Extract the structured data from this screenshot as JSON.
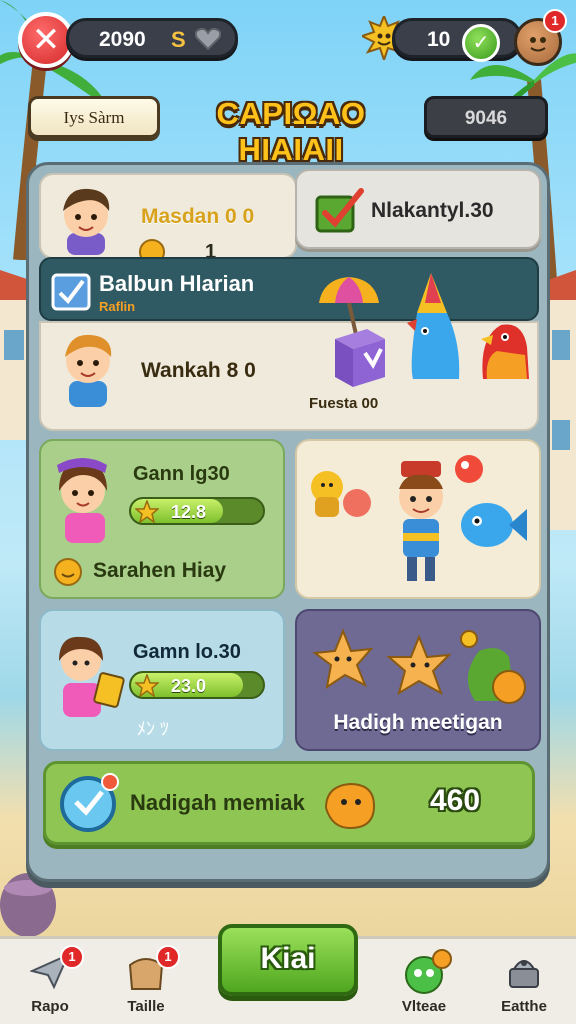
{
  "hud": {
    "coins": "2090",
    "currency_symbol": "S",
    "gems": "10",
    "plus_label": "✓",
    "close_label": "✕",
    "notification_count": "1"
  },
  "header": {
    "name_tag": "Iys Sàrm",
    "title": "CAPIΩAO HIAIAII",
    "score": "9046"
  },
  "panel": {
    "player1": {
      "name": "Masdan 0 0",
      "coins": "1"
    },
    "action_button": {
      "label": "Nlakantyl.30"
    },
    "banner": {
      "title": "Balbun Hlarian",
      "subtitle": "Raflin"
    },
    "player2": {
      "name": "Wankah 8 0",
      "caption": "Fuesta 00"
    },
    "player3": {
      "name": "Gann lg30",
      "progress_text": "12.8",
      "progress": 0.7,
      "footer": "Sarahen Hiay"
    },
    "player4": {
      "name": "Gamn lo.30",
      "progress_text": "23.0",
      "progress": 0.85,
      "footer": "ﾒﾝ ﾂ"
    },
    "purple_card": {
      "label": "Hadigh meetigan"
    },
    "bottom_card": {
      "label": "Nadigah memiak",
      "value": "460"
    }
  },
  "nav": {
    "items": [
      {
        "label": "Rapo",
        "badge": "1"
      },
      {
        "label": "Taille",
        "badge": "1"
      },
      {
        "label": "Kiai"
      },
      {
        "label": "Vlteae"
      },
      {
        "label": "Eatthe"
      }
    ]
  },
  "colors": {
    "accent_green": "#8fc653",
    "title_gold": "#ffc21a",
    "alert_red": "#e02828"
  }
}
